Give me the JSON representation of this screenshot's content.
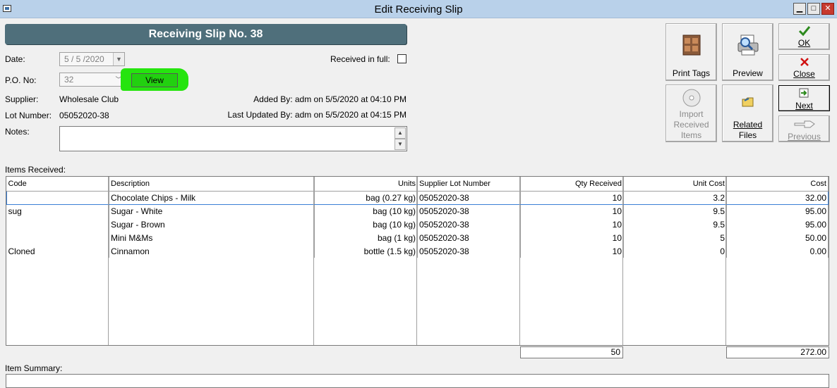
{
  "window": {
    "title": "Edit Receiving Slip",
    "minimize": "▁",
    "maximize": "□",
    "close": "✕"
  },
  "header": {
    "title": "Receiving Slip No. 38"
  },
  "form": {
    "date_label": "Date:",
    "date_value": "5 / 5 /2020",
    "received_in_full_label": "Received in full:",
    "po_label": "P.O. No:",
    "po_value": "32",
    "view_label": "View",
    "supplier_label": "Supplier:",
    "supplier_value": "Wholesale Club",
    "added_by": "Added By: adm on 5/5/2020 at 04:10 PM",
    "lot_label": "Lot Number:",
    "lot_value": "05052020-38",
    "last_updated": "Last Updated By: adm on 5/5/2020 at 04:15 PM",
    "notes_label": "Notes:"
  },
  "toolbar": {
    "print_tags": "Print Tags",
    "preview": "Preview",
    "ok": "OK",
    "close": "Close",
    "import_line1": "Import",
    "import_line2": "Received",
    "import_line3": "Items",
    "related_line1": "Related",
    "related_line2": "Files",
    "next": "Next",
    "previous": "Previous"
  },
  "items": {
    "section_label": "Items Received:",
    "columns": [
      "Code",
      "Description",
      "Units",
      "Supplier Lot Number",
      "Qty Received",
      "Unit Cost",
      "Cost"
    ],
    "rows": [
      [
        "",
        "Chocolate Chips - Milk",
        "bag (0.27 kg)",
        "05052020-38",
        "10",
        "3.2",
        "32.00"
      ],
      [
        "sug",
        "Sugar - White",
        "bag (10 kg)",
        "05052020-38",
        "10",
        "9.5",
        "95.00"
      ],
      [
        "",
        "Sugar - Brown",
        "bag (10 kg)",
        "05052020-38",
        "10",
        "9.5",
        "95.00"
      ],
      [
        "",
        "Mini M&Ms",
        "bag (1 kg)",
        "05052020-38",
        "10",
        "5",
        "50.00"
      ],
      [
        "Cloned",
        "Cinnamon",
        "bottle (1.5 kg)",
        "05052020-38",
        "10",
        "0",
        "0.00"
      ]
    ],
    "total_qty": "50",
    "total_cost": "272.00"
  },
  "summary": {
    "section_label": "Item Summary:"
  }
}
